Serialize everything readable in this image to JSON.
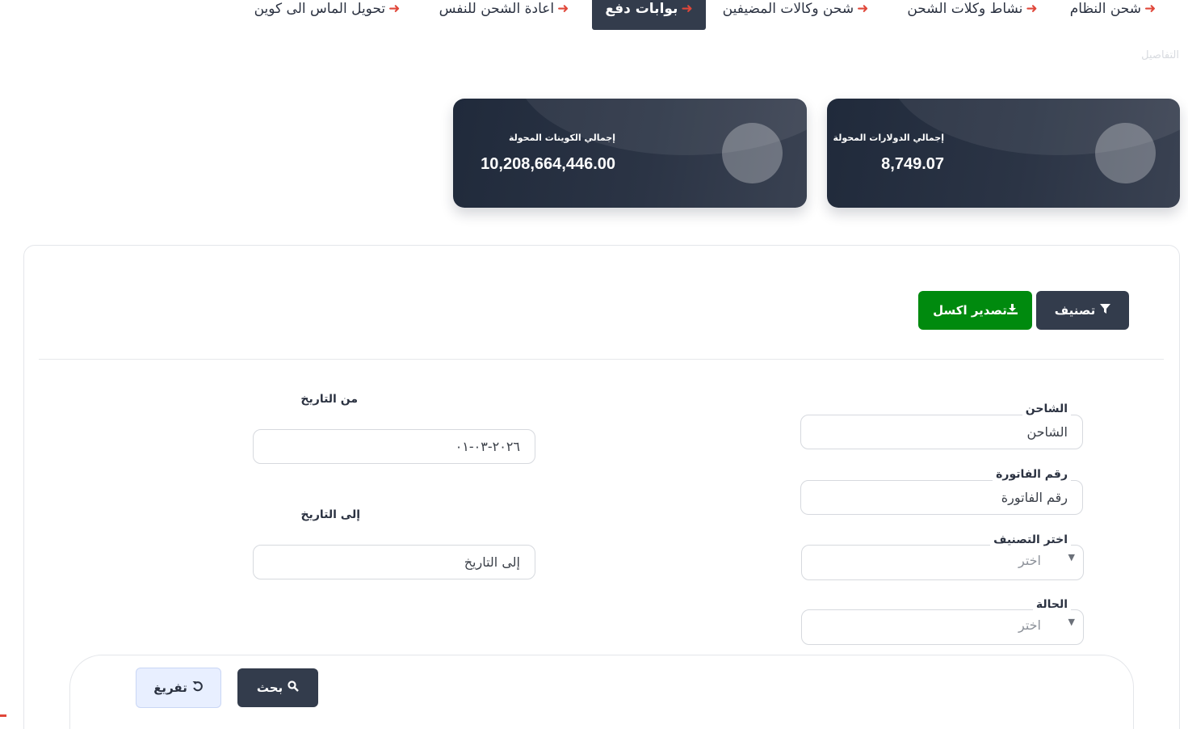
{
  "tabs": [
    {
      "label": "شحن النظام",
      "active": false
    },
    {
      "label": "نشاط وكلات الشحن",
      "active": false
    },
    {
      "label": "شحن وكالات المضيفين",
      "active": false
    },
    {
      "label": "بوابات دفع",
      "active": true
    },
    {
      "label": "اعادة الشحن للنفس",
      "active": false
    },
    {
      "label": "تحويل الماس الى كوين",
      "active": false
    }
  ],
  "breadcrumb": "التفاصيل",
  "stats": [
    {
      "label": "إجمالي الدولارات المحولة",
      "value": "8,749.07"
    },
    {
      "label": "إجمالي الكوينات المحولة",
      "value": "10,208,664,446.00"
    }
  ],
  "toolbar": {
    "filter_label": "تصنيف",
    "export_label": "تصدير اكسل"
  },
  "form": {
    "charger": {
      "label": "الشاحن",
      "placeholder": "الشاحن"
    },
    "invoice": {
      "label": "رقم الفاتورة",
      "placeholder": "رقم الفاتورة"
    },
    "category": {
      "label": "اختر التصنيف",
      "selected": "اختر"
    },
    "status": {
      "label": "الحالة",
      "selected": "اختر"
    },
    "from_date": {
      "label": "من التاريخ",
      "value": "٢٠٢٦-٠٣-٠١"
    },
    "to_date": {
      "label": "إلى التاريخ",
      "placeholder": "إلى التاريخ"
    }
  },
  "actions": {
    "search_label": "بحث",
    "reset_label": "تفريغ"
  },
  "colors": {
    "accent_dark": "#333c4c",
    "export_green": "#008a0e",
    "arrow_red": "#e0473a"
  },
  "icons": {
    "tab_arrow": "arrow-right-icon",
    "filter": "filter-icon",
    "export": "download-icon",
    "search": "search-icon",
    "reset": "undo-icon",
    "caret": "caret-down-icon"
  }
}
